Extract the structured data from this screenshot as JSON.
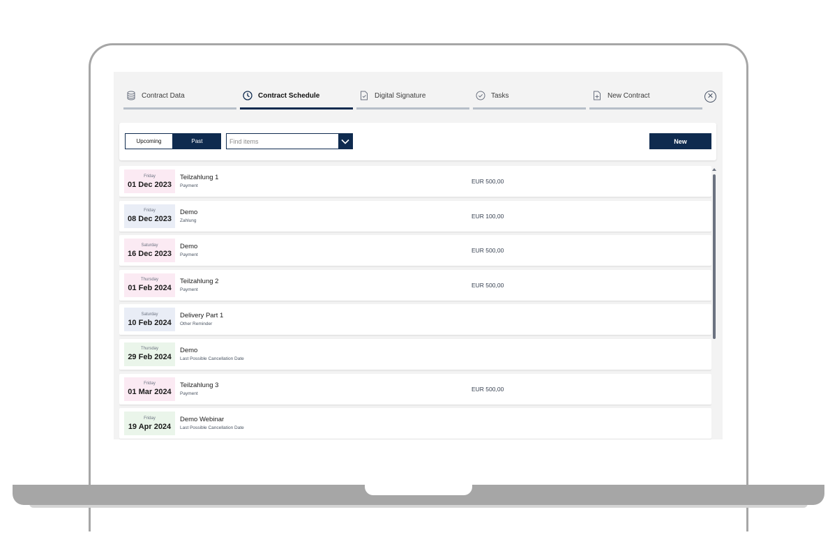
{
  "tabs": [
    {
      "label": "Contract Data",
      "icon": "database-icon",
      "active": false
    },
    {
      "label": "Contract Schedule",
      "icon": "clock-icon",
      "active": true
    },
    {
      "label": "Digital Signature",
      "icon": "document-check-icon",
      "active": false
    },
    {
      "label": "Tasks",
      "icon": "check-circle-icon",
      "active": false
    },
    {
      "label": "New Contract",
      "icon": "document-plus-icon",
      "active": false
    }
  ],
  "close_icon": "close-icon",
  "toolbar": {
    "upcoming_label": "Upcoming",
    "past_label": "Past",
    "search_placeholder": "Find items",
    "search_value": "",
    "new_label": "New"
  },
  "colors": {
    "accent": "#0f2b4f",
    "payment_bg": "#fbeaf3",
    "zahlung_bg": "#e9edf6",
    "cancellation_bg": "#eaf5ea"
  },
  "items": [
    {
      "day": "Friday",
      "date": "01 Dec 2023",
      "title": "Teilzahlung 1",
      "subtitle": "Payment",
      "amount": "EUR 500,00",
      "tone": "pink"
    },
    {
      "day": "Friday",
      "date": "08 Dec 2023",
      "title": "Demo",
      "subtitle": "Zahlung",
      "amount": "EUR 100,00",
      "tone": "blue"
    },
    {
      "day": "Saturday",
      "date": "16 Dec 2023",
      "title": "Demo",
      "subtitle": "Payment",
      "amount": "EUR 500,00",
      "tone": "pink"
    },
    {
      "day": "Thursday",
      "date": "01 Feb 2024",
      "title": "Teilzahlung 2",
      "subtitle": "Payment",
      "amount": "EUR 500,00",
      "tone": "pink"
    },
    {
      "day": "Saturday",
      "date": "10 Feb 2024",
      "title": "Delivery Part 1",
      "subtitle": "Other Reminder",
      "amount": "",
      "tone": "blue"
    },
    {
      "day": "Thursday",
      "date": "29 Feb 2024",
      "title": "Demo",
      "subtitle": "Last Possible Cancellation Date",
      "amount": "",
      "tone": "green"
    },
    {
      "day": "Friday",
      "date": "01 Mar 2024",
      "title": "Teilzahlung 3",
      "subtitle": "Payment",
      "amount": "EUR 500,00",
      "tone": "pink"
    },
    {
      "day": "Friday",
      "date": "19 Apr 2024",
      "title": "Demo Webinar",
      "subtitle": "Last Possible Cancellation Date",
      "amount": "",
      "tone": "green"
    }
  ]
}
